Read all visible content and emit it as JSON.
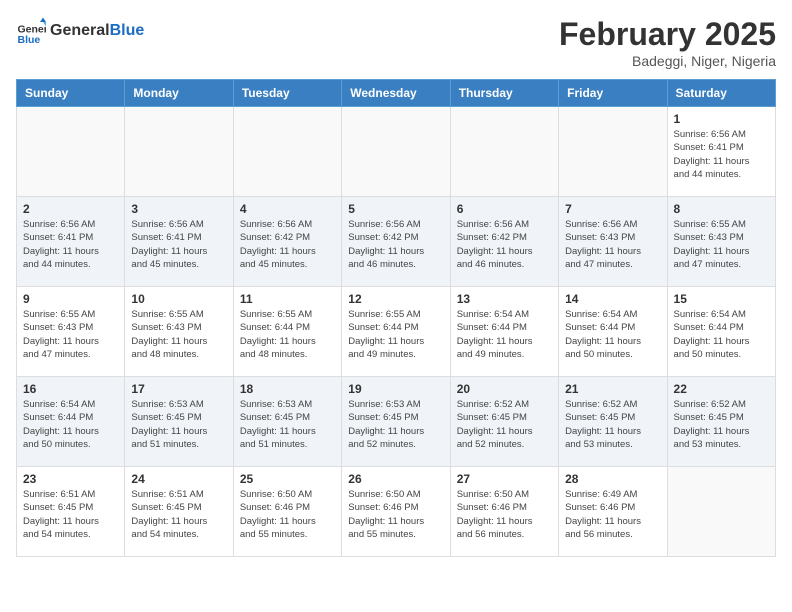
{
  "header": {
    "logo_general": "General",
    "logo_blue": "Blue",
    "title": "February 2025",
    "subtitle": "Badeggi, Niger, Nigeria"
  },
  "weekdays": [
    "Sunday",
    "Monday",
    "Tuesday",
    "Wednesday",
    "Thursday",
    "Friday",
    "Saturday"
  ],
  "weeks": [
    {
      "days": [
        {
          "num": "",
          "info": ""
        },
        {
          "num": "",
          "info": ""
        },
        {
          "num": "",
          "info": ""
        },
        {
          "num": "",
          "info": ""
        },
        {
          "num": "",
          "info": ""
        },
        {
          "num": "",
          "info": ""
        },
        {
          "num": "1",
          "info": "Sunrise: 6:56 AM\nSunset: 6:41 PM\nDaylight: 11 hours\nand 44 minutes."
        }
      ]
    },
    {
      "days": [
        {
          "num": "2",
          "info": "Sunrise: 6:56 AM\nSunset: 6:41 PM\nDaylight: 11 hours\nand 44 minutes."
        },
        {
          "num": "3",
          "info": "Sunrise: 6:56 AM\nSunset: 6:41 PM\nDaylight: 11 hours\nand 45 minutes."
        },
        {
          "num": "4",
          "info": "Sunrise: 6:56 AM\nSunset: 6:42 PM\nDaylight: 11 hours\nand 45 minutes."
        },
        {
          "num": "5",
          "info": "Sunrise: 6:56 AM\nSunset: 6:42 PM\nDaylight: 11 hours\nand 46 minutes."
        },
        {
          "num": "6",
          "info": "Sunrise: 6:56 AM\nSunset: 6:42 PM\nDaylight: 11 hours\nand 46 minutes."
        },
        {
          "num": "7",
          "info": "Sunrise: 6:56 AM\nSunset: 6:43 PM\nDaylight: 11 hours\nand 47 minutes."
        },
        {
          "num": "8",
          "info": "Sunrise: 6:55 AM\nSunset: 6:43 PM\nDaylight: 11 hours\nand 47 minutes."
        }
      ]
    },
    {
      "days": [
        {
          "num": "9",
          "info": "Sunrise: 6:55 AM\nSunset: 6:43 PM\nDaylight: 11 hours\nand 47 minutes."
        },
        {
          "num": "10",
          "info": "Sunrise: 6:55 AM\nSunset: 6:43 PM\nDaylight: 11 hours\nand 48 minutes."
        },
        {
          "num": "11",
          "info": "Sunrise: 6:55 AM\nSunset: 6:44 PM\nDaylight: 11 hours\nand 48 minutes."
        },
        {
          "num": "12",
          "info": "Sunrise: 6:55 AM\nSunset: 6:44 PM\nDaylight: 11 hours\nand 49 minutes."
        },
        {
          "num": "13",
          "info": "Sunrise: 6:54 AM\nSunset: 6:44 PM\nDaylight: 11 hours\nand 49 minutes."
        },
        {
          "num": "14",
          "info": "Sunrise: 6:54 AM\nSunset: 6:44 PM\nDaylight: 11 hours\nand 50 minutes."
        },
        {
          "num": "15",
          "info": "Sunrise: 6:54 AM\nSunset: 6:44 PM\nDaylight: 11 hours\nand 50 minutes."
        }
      ]
    },
    {
      "days": [
        {
          "num": "16",
          "info": "Sunrise: 6:54 AM\nSunset: 6:44 PM\nDaylight: 11 hours\nand 50 minutes."
        },
        {
          "num": "17",
          "info": "Sunrise: 6:53 AM\nSunset: 6:45 PM\nDaylight: 11 hours\nand 51 minutes."
        },
        {
          "num": "18",
          "info": "Sunrise: 6:53 AM\nSunset: 6:45 PM\nDaylight: 11 hours\nand 51 minutes."
        },
        {
          "num": "19",
          "info": "Sunrise: 6:53 AM\nSunset: 6:45 PM\nDaylight: 11 hours\nand 52 minutes."
        },
        {
          "num": "20",
          "info": "Sunrise: 6:52 AM\nSunset: 6:45 PM\nDaylight: 11 hours\nand 52 minutes."
        },
        {
          "num": "21",
          "info": "Sunrise: 6:52 AM\nSunset: 6:45 PM\nDaylight: 11 hours\nand 53 minutes."
        },
        {
          "num": "22",
          "info": "Sunrise: 6:52 AM\nSunset: 6:45 PM\nDaylight: 11 hours\nand 53 minutes."
        }
      ]
    },
    {
      "days": [
        {
          "num": "23",
          "info": "Sunrise: 6:51 AM\nSunset: 6:45 PM\nDaylight: 11 hours\nand 54 minutes."
        },
        {
          "num": "24",
          "info": "Sunrise: 6:51 AM\nSunset: 6:45 PM\nDaylight: 11 hours\nand 54 minutes."
        },
        {
          "num": "25",
          "info": "Sunrise: 6:50 AM\nSunset: 6:46 PM\nDaylight: 11 hours\nand 55 minutes."
        },
        {
          "num": "26",
          "info": "Sunrise: 6:50 AM\nSunset: 6:46 PM\nDaylight: 11 hours\nand 55 minutes."
        },
        {
          "num": "27",
          "info": "Sunrise: 6:50 AM\nSunset: 6:46 PM\nDaylight: 11 hours\nand 56 minutes."
        },
        {
          "num": "28",
          "info": "Sunrise: 6:49 AM\nSunset: 6:46 PM\nDaylight: 11 hours\nand 56 minutes."
        },
        {
          "num": "",
          "info": ""
        }
      ]
    }
  ]
}
